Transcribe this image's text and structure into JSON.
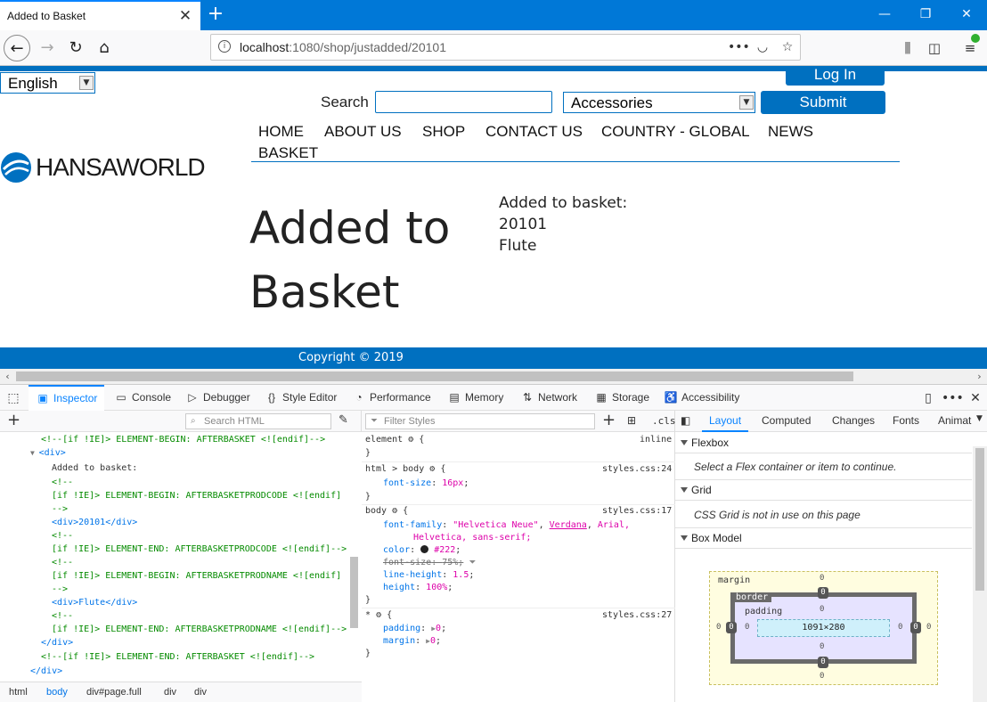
{
  "browser": {
    "tab_title": "Added to Basket",
    "url_host": "localhost",
    "url_path": ":1080/shop/justadded/20101",
    "page_actions": "•••"
  },
  "page": {
    "language": "English",
    "login_label": "Log In",
    "search_label": "Search",
    "search_value": "",
    "category": "Accessories",
    "submit_label": "Submit",
    "menu": [
      "HOME",
      "ABOUT US",
      "SHOP",
      "CONTACT US",
      "COUNTRY - GLOBAL",
      "NEWS",
      "BASKET"
    ],
    "logo_text": "HANSAWORLD",
    "heading_line1": "Added to",
    "heading_line2": "Basket",
    "info_label": "Added to basket:",
    "item_code": "20101",
    "item_name": "Flute",
    "footer": "Copyright © 2019"
  },
  "devtools": {
    "tabs": [
      "Inspector",
      "Console",
      "Debugger",
      "Style Editor",
      "Performance",
      "Memory",
      "Network",
      "Storage",
      "Accessibility"
    ],
    "search_html_placeholder": "Search HTML",
    "filter_styles_placeholder": "Filter Styles",
    "cls_label": ".cls",
    "html_lines": [
      "<!--[if !IE]> ELEMENT-BEGIN: AFTERBASKET <![endif]-->",
      "<div>",
      "Added to basket:",
      "<!--",
      "[if !IE]> ELEMENT-BEGIN: AFTERBASKETPRODCODE <![endif]",
      "-->",
      "<div>20101</div>",
      "<!--",
      "[if !IE]> ELEMENT-END: AFTERBASKETPRODCODE <![endif]-->",
      "<!--",
      "[if !IE]> ELEMENT-BEGIN: AFTERBASKETPRODNAME <![endif]",
      "-->",
      "<div>Flute</div>",
      "<!--",
      "[if !IE]> ELEMENT-END: AFTERBASKETPRODNAME <![endif]-->",
      "</div>",
      "<!--[if !IE]> ELEMENT-END: AFTERBASKET <![endif]-->",
      "</div>"
    ],
    "breadcrumbs": [
      "html",
      "body",
      "div#page.full",
      "div",
      "div"
    ],
    "rules": {
      "element_selector": "element",
      "element_source": "inline",
      "r1_selector": "html > body",
      "r1_source": "styles.css:24",
      "r1_prop": "font-size",
      "r1_val": "16px",
      "r2_selector": "body",
      "r2_source": "styles.css:17",
      "r2_ff_prop": "font-family",
      "r2_ff_val1": "\"Helvetica Neue\"",
      "r2_ff_val2": "Verdana",
      "r2_ff_val3": "Arial,",
      "r2_ff_val4": "Helvetica, sans-serif;",
      "r2_color_prop": "color",
      "r2_color_val": "#222",
      "r2_fs_prop": "font-size",
      "r2_fs_val": "75%",
      "r2_lh_prop": "line-height",
      "r2_lh_val": "1.5",
      "r2_h_prop": "height",
      "r2_h_val": "100%",
      "r3_selector": "*",
      "r3_source": "styles.css:27",
      "r3_p_prop": "padding",
      "r3_p_val": "0",
      "r3_m_prop": "margin",
      "r3_m_val": "0"
    },
    "side_tabs": [
      "Layout",
      "Computed",
      "Changes",
      "Fonts",
      "Animat"
    ],
    "flexbox_title": "Flexbox",
    "flexbox_note": "Select a Flex container or item to continue.",
    "grid_title": "Grid",
    "grid_note": "CSS Grid is not in use on this page",
    "boxmodel_title": "Box Model",
    "boxmodel": {
      "margin_label": "margin",
      "border_label": "border",
      "padding_label": "padding",
      "content_size": "1091×280",
      "margin_top": "0",
      "margin_right": "0",
      "margin_bottom": "0",
      "margin_left": "0",
      "border_top": "0",
      "border_right": "0",
      "border_bottom": "0",
      "border_left": "0",
      "padding_top": "0",
      "padding_right": "0",
      "padding_bottom": "0",
      "padding_left": "0"
    }
  }
}
